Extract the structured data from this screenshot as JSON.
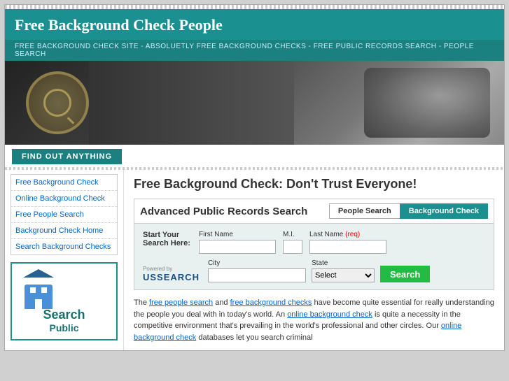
{
  "site": {
    "title": "Free Background Check People",
    "nav_text": "FREE BACKGROUND CHECK SITE - ABSOLUETLY FREE BACKGROUND CHECKS - FREE PUBLIC RECORDS SEARCH - PEOPLE SEARCH",
    "find_bar": "FIND OUT ANYTHING"
  },
  "sidebar": {
    "nav_links": [
      {
        "id": "free-bg",
        "label": "Free Background Check",
        "href": "#"
      },
      {
        "id": "online-bg",
        "label": "Online Background Check",
        "href": "#"
      },
      {
        "id": "free-people",
        "label": "Free People Search",
        "href": "#"
      },
      {
        "id": "bg-home",
        "label": "Background Check Home",
        "href": "#"
      },
      {
        "id": "search-bg",
        "label": "Search Background Checks",
        "href": "#"
      }
    ],
    "box_title1": "Search",
    "box_title2": "Public"
  },
  "main": {
    "heading": "Free Background Check: Don't Trust Everyone!",
    "search_panel": {
      "adv_label": "Advanced Public Records Search",
      "tab_people": "People Search",
      "tab_bg": "Background Check",
      "form": {
        "start_label1": "Start Your",
        "start_label2": "Search Here:",
        "field_first": "First Name",
        "field_mi": "M.I.",
        "field_last": "Last Name",
        "field_last_req": "(req)",
        "field_city": "City",
        "field_state": "State",
        "state_placeholder": "Select",
        "powered_by": "Powered by",
        "ussearch": "USSEARCH",
        "search_btn": "Search"
      }
    },
    "desc_text": "The free people search and free background checks have become quite essential for really understanding the people you deal with in today's world. An online background check is quite a necessity in the competitive environment that's prevailing in the world's professional and other circles. Our online background check databases let you search criminal",
    "desc_links": {
      "people_search": "free people search",
      "bg_checks": "free background checks",
      "online_bg": "online background check",
      "online_bg2": "online background check"
    }
  }
}
